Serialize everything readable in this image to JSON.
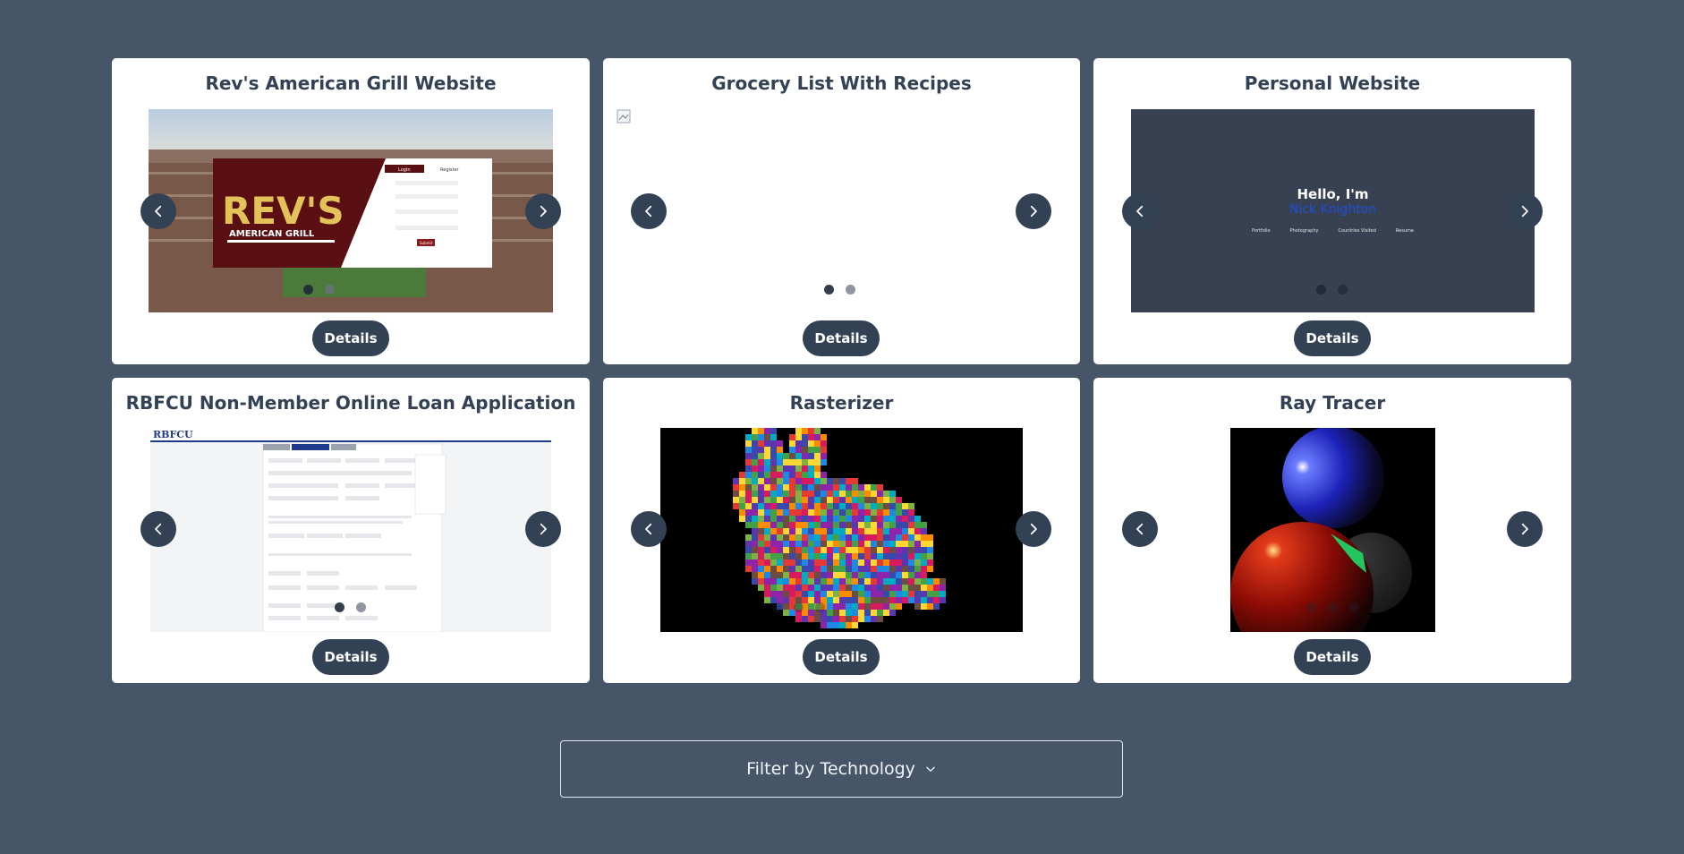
{
  "projects": [
    {
      "title": "Rev's American Grill Website",
      "details_label": "Details",
      "slide": {
        "logo_line1": "REV'S",
        "logo_line2": "AMERICAN GRILL",
        "login_tab": "Login",
        "register_tab": "Register",
        "submit_label": "Submit"
      },
      "dots": 2
    },
    {
      "title": "Grocery List With Recipes",
      "details_label": "Details",
      "slide": {},
      "dots": 2
    },
    {
      "title": "Personal Website",
      "details_label": "Details",
      "slide": {
        "greeting": "Hello, I'm",
        "name": "Nick Knighton",
        "nav": [
          "Portfolio",
          "Photography",
          "Countries Visited",
          "Resume"
        ]
      },
      "dots": 2
    },
    {
      "title": "RBFCU Non-Member Online Loan Application",
      "details_label": "Details",
      "slide": {
        "logo": "RBFCU"
      },
      "dots": 2
    },
    {
      "title": "Rasterizer",
      "details_label": "Details",
      "slide": {},
      "dots": 3
    },
    {
      "title": "Ray Tracer",
      "details_label": "Details",
      "slide": {},
      "dots": 3
    }
  ],
  "icons": {
    "prev": "chevron-left-icon",
    "next": "chevron-right-icon",
    "dropdown": "chevron-down-icon"
  },
  "filter": {
    "label": "Filter by Technology"
  },
  "colors": {
    "page_bg": "#475569",
    "card_bg": "#ffffff",
    "accent": "#334155"
  }
}
